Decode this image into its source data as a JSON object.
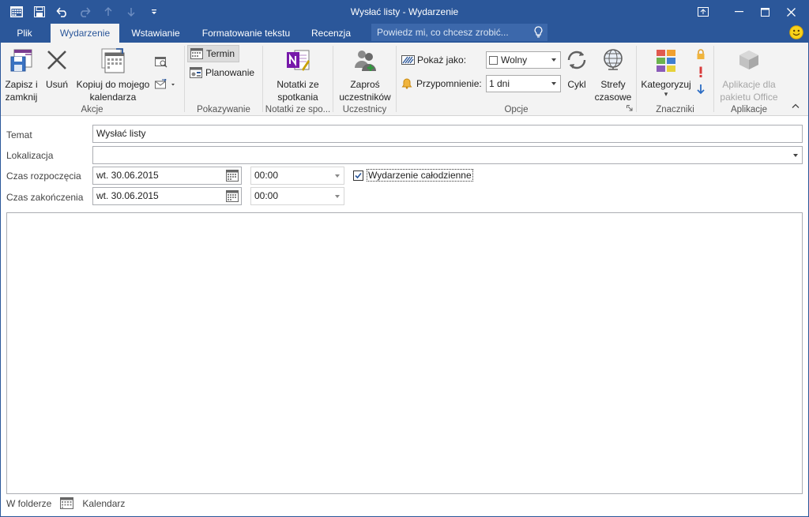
{
  "window": {
    "title": "Wysłać listy - Wydarzenie",
    "accent": "#2b579a"
  },
  "qat": {
    "icons": [
      "calendar-icon",
      "save-icon",
      "undo-icon",
      "redo-icon",
      "up-arrow-icon",
      "down-arrow-icon",
      "customize-icon"
    ]
  },
  "tabs": [
    {
      "label": "Plik"
    },
    {
      "label": "Wydarzenie"
    },
    {
      "label": "Wstawianie"
    },
    {
      "label": "Formatowanie tekstu"
    },
    {
      "label": "Recenzja"
    }
  ],
  "tellme": {
    "placeholder": "Powiedz mi, co chcesz zrobić..."
  },
  "ribbon": {
    "actions": {
      "save_close": "Zapisz i\nzamknij",
      "delete": "Usuń",
      "copy": "Kopiuj do mojego\nkalendarza",
      "label": "Akcje"
    },
    "show": {
      "appointment": "Termin",
      "scheduling": "Planowanie",
      "label": "Pokazywanie"
    },
    "notes": {
      "meeting_notes": "Notatki ze\nspotkania",
      "label": "Notatki ze spo..."
    },
    "attendees": {
      "invite": "Zaproś\nuczestników",
      "label": "Uczestnicy"
    },
    "options": {
      "show_as_label": "Pokaż jako:",
      "show_as_value": "Wolny",
      "reminder_label": "Przypomnienie:",
      "reminder_value": "1 dni",
      "recurrence": "Cykl",
      "timezones": "Strefy\nczasowe",
      "label": "Opcje"
    },
    "tags": {
      "categorize": "Kategoryzuj",
      "label": "Znaczniki"
    },
    "addins": {
      "office_addins": "Aplikacje dla\npakietu Office",
      "label": "Aplikacje"
    }
  },
  "form": {
    "subject_label": "Temat",
    "subject_value": "Wysłać listy",
    "location_label": "Lokalizacja",
    "location_value": "",
    "start_label": "Czas rozpoczęcia",
    "start_date": "wt. 30.06.2015",
    "start_time": "00:00",
    "end_label": "Czas zakończenia",
    "end_date": "wt. 30.06.2015",
    "end_time": "00:00",
    "all_day_label": "Wydarzenie całodzienne",
    "all_day_checked": true
  },
  "status": {
    "in_folder_label": "W folderze",
    "folder_name": "Kalendarz"
  }
}
